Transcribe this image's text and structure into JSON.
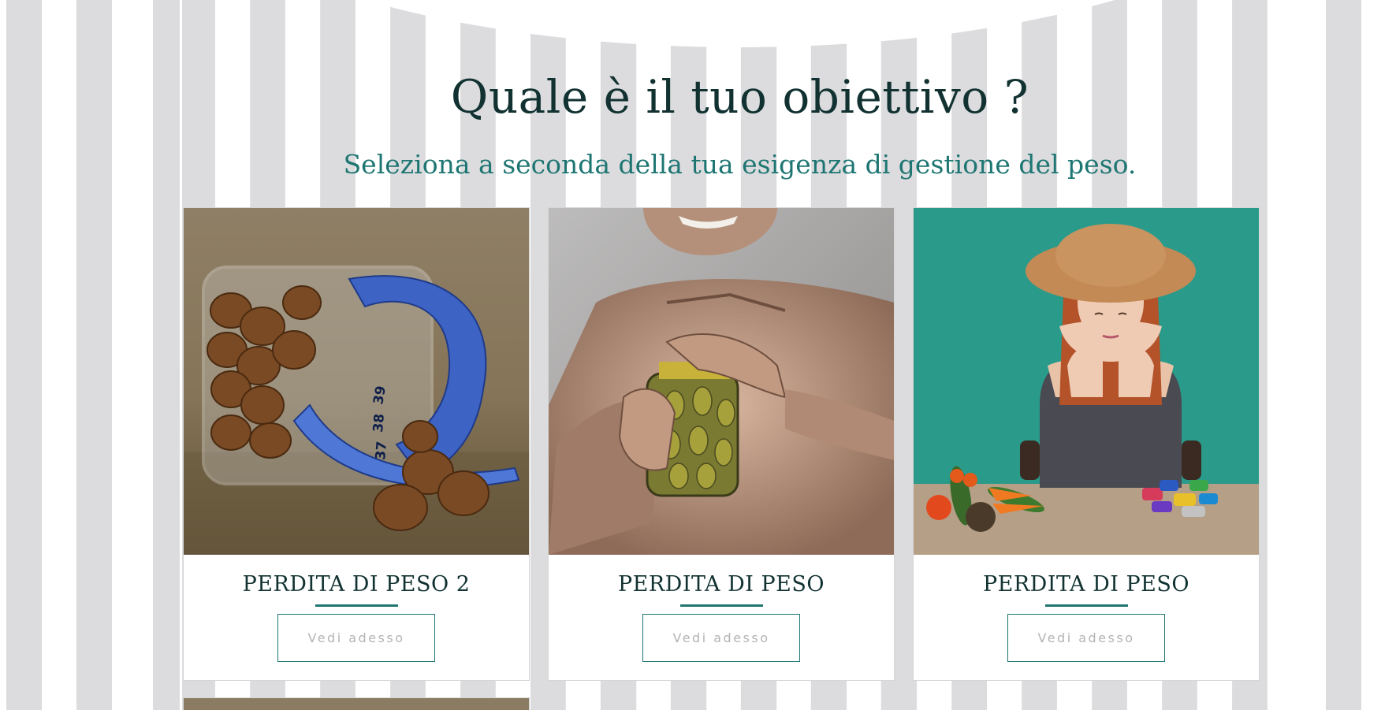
{
  "header": {
    "title": "Quale è il tuo obiettivo ?",
    "subtitle": "Seleziona a seconda della tua esigenza di gestione del peso."
  },
  "cards": [
    {
      "title": "PERDITA DI PESO 2",
      "button_label": "Vedi adesso",
      "image_subject": "hazelnuts-jar-measuring-tape"
    },
    {
      "title": "PERDITA DI PESO",
      "button_label": "Vedi adesso",
      "image_subject": "man-opening-pickle-jar"
    },
    {
      "title": "PERDITA DI PESO",
      "button_label": "Vedi adesso",
      "image_subject": "woman-choosing-vegetables-or-candy"
    }
  ],
  "colors": {
    "heading": "#123232",
    "accent_teal": "#1e7673",
    "button_text": "#b2b4b4",
    "stripe_gray": "#dcdcde",
    "card_border": "#d6d6d6"
  }
}
